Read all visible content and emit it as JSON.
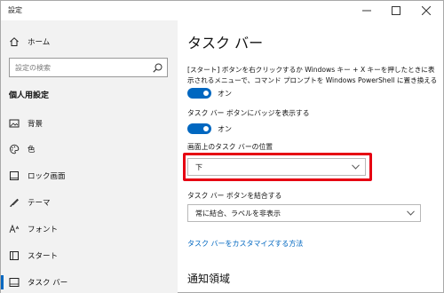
{
  "window": {
    "title": "設定",
    "controls": {
      "minimize": "minimize",
      "maximize": "maximize",
      "close": "close"
    }
  },
  "sidebar": {
    "home_label": "ホーム",
    "search_placeholder": "設定の検索",
    "section_heading": "個人用設定",
    "items": [
      {
        "label": "背景",
        "icon": "image-icon"
      },
      {
        "label": "色",
        "icon": "palette-icon"
      },
      {
        "label": "ロック画面",
        "icon": "lock-screen-icon"
      },
      {
        "label": "テーマ",
        "icon": "theme-brush-icon"
      },
      {
        "label": "フォント",
        "icon": "font-icon"
      },
      {
        "label": "スタート",
        "icon": "start-icon"
      },
      {
        "label": "タスク バー",
        "icon": "taskbar-icon",
        "selected": true
      }
    ]
  },
  "main": {
    "title": "タスク バー",
    "powershell_desc": "[スタート] ボタンを右クリックするか Windows キー + X キーを押したときに表示されるメニューで、コマンド プロンプトを Windows PowerShell に置き換える",
    "powershell_toggle": {
      "state": "オン",
      "on": true
    },
    "badge_label": "タスク バー ボタンにバッジを表示する",
    "badge_toggle": {
      "state": "オン",
      "on": true
    },
    "position_label": "画面上のタスク バーの位置",
    "position_value": "下",
    "combine_label": "タスク バー ボタンを結合する",
    "combine_value": "常に結合、ラベルを非表示",
    "customize_link": "タスク バーをカスタマイズする方法",
    "notification_heading": "通知領域"
  },
  "colors": {
    "accent": "#0067c0",
    "highlight_border": "#e60012",
    "sidebar_bg": "#f2f2f2"
  }
}
